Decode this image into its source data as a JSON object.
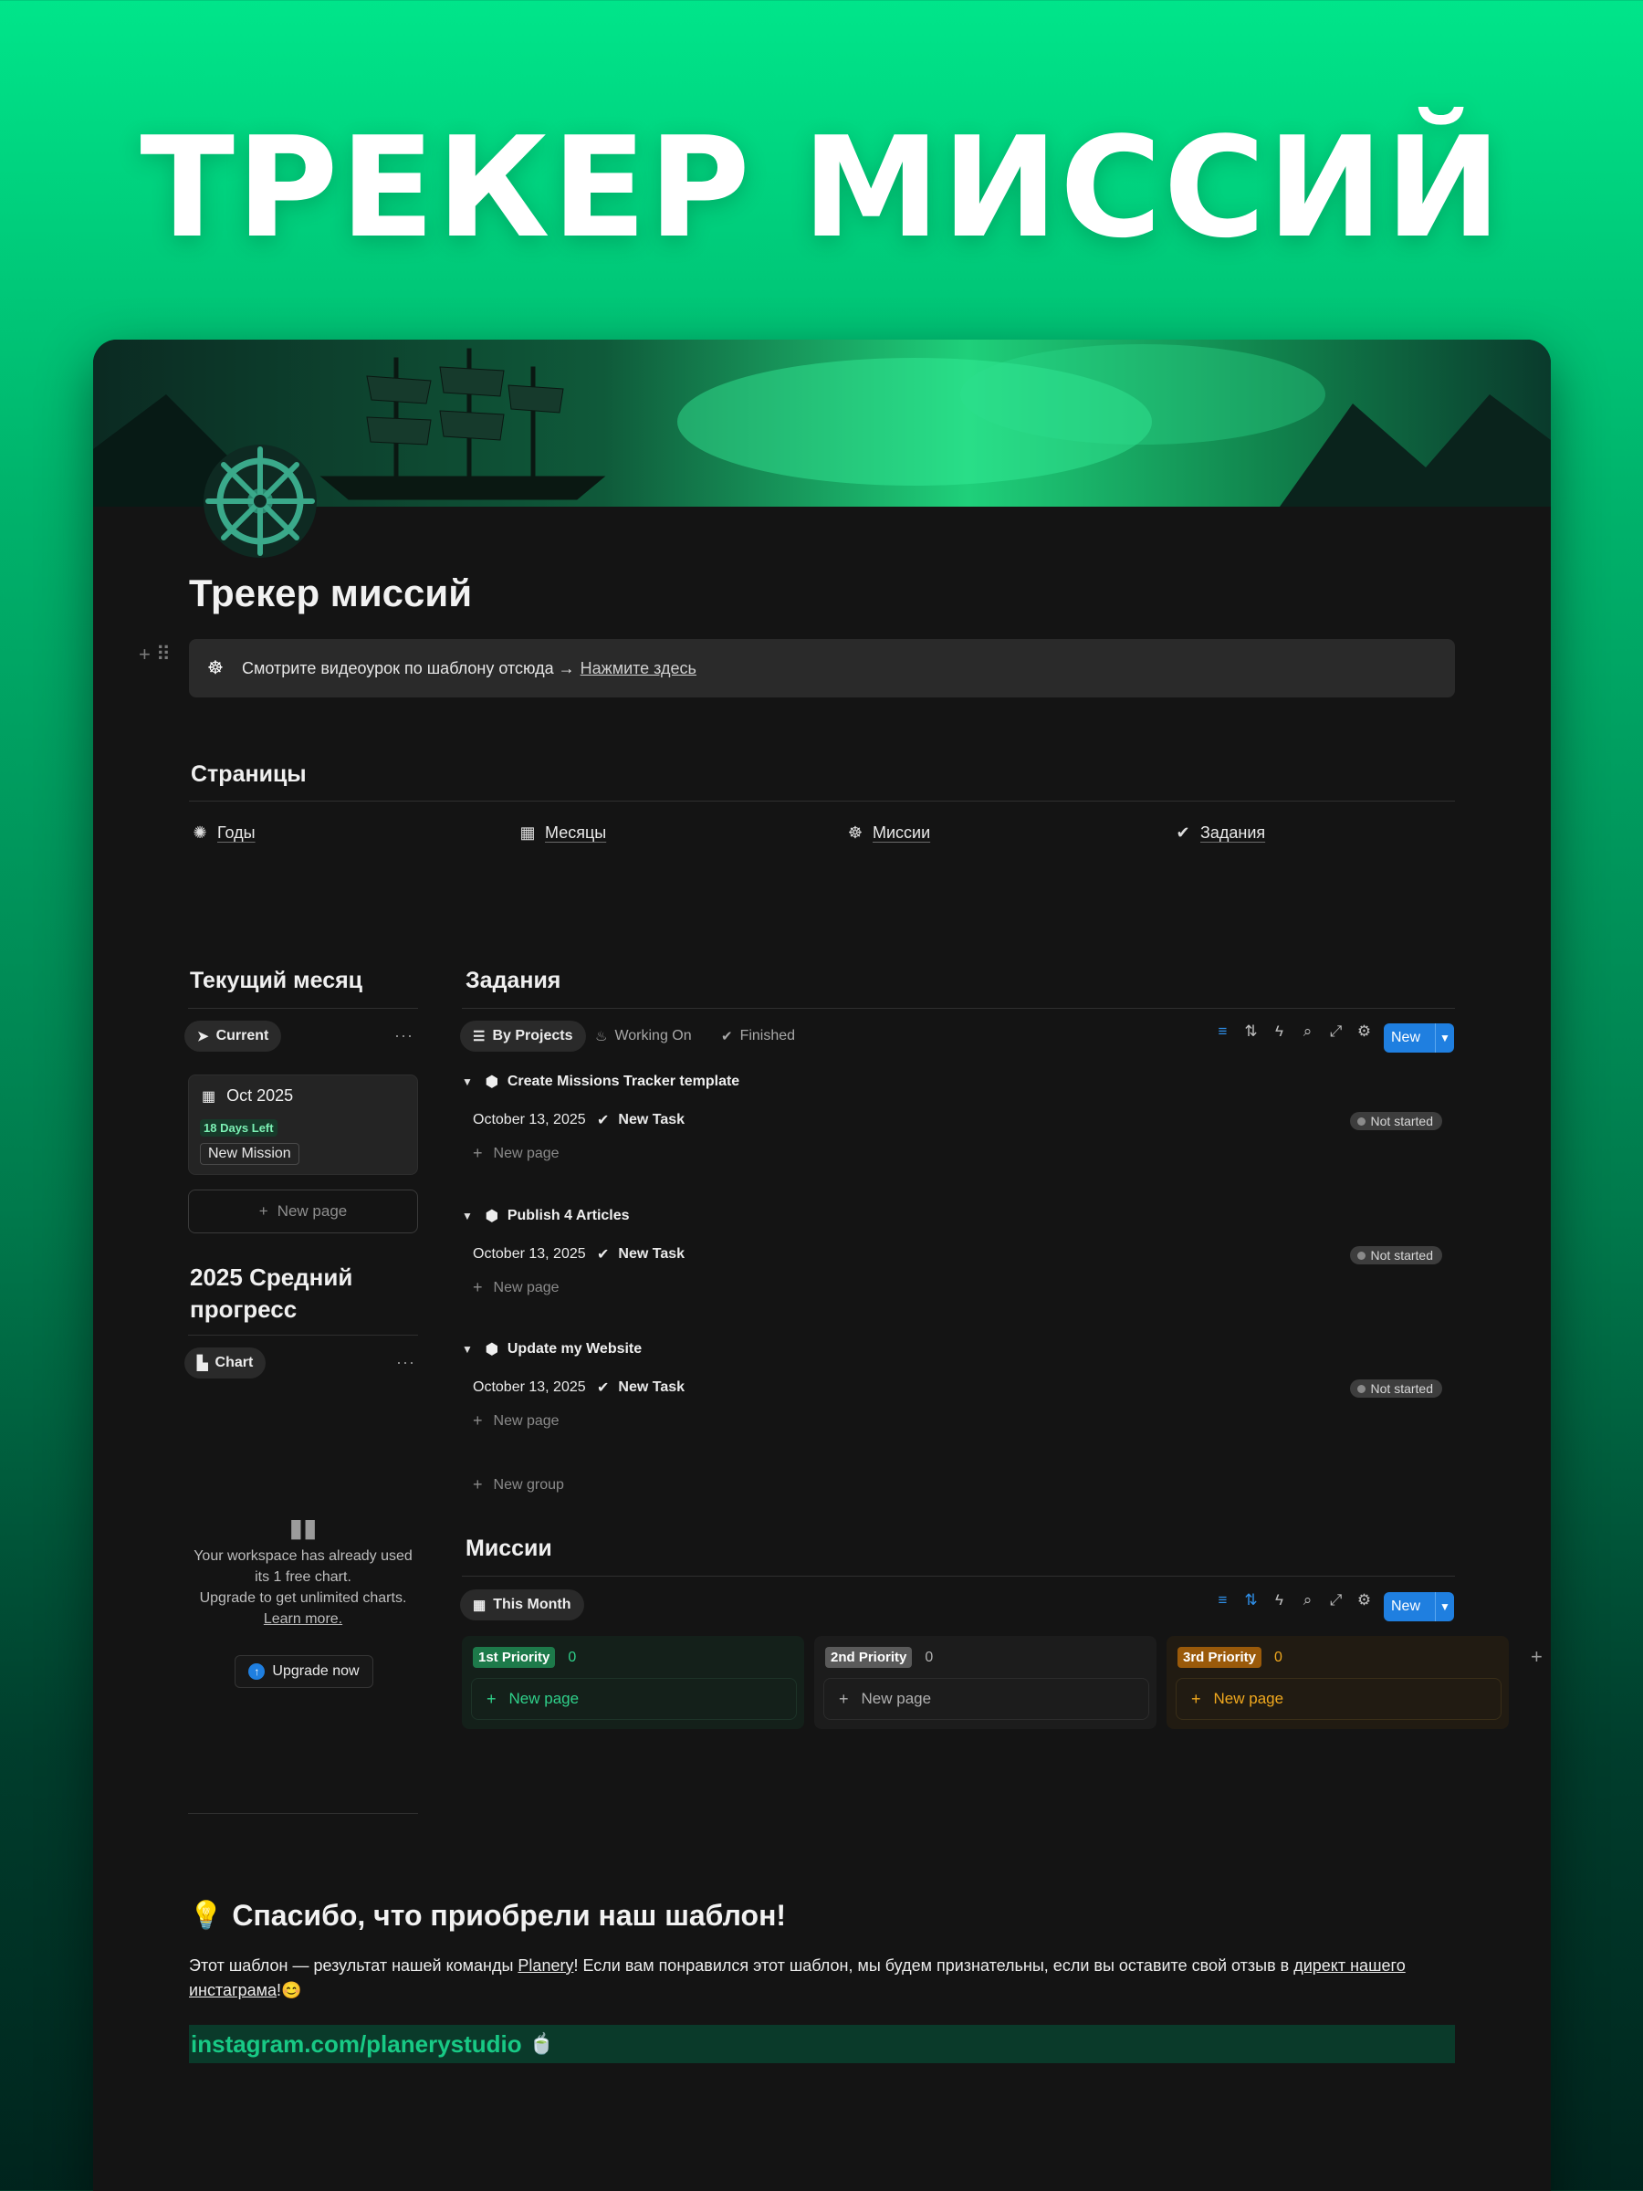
{
  "hero": {
    "title": "ТРЕКЕР МИССИЙ"
  },
  "page": {
    "title": "Трекер миссий",
    "callout": {
      "icon": "helm-icon",
      "text": "Смотрите видеоурок по шаблону отсюда →",
      "link": "Нажмите здесь"
    }
  },
  "pages_section": {
    "heading": "Страницы",
    "links": [
      {
        "icon": "sparkle-icon",
        "label": "Годы"
      },
      {
        "icon": "calendar-icon",
        "label": "Месяцы"
      },
      {
        "icon": "helm-icon",
        "label": "Миссии"
      },
      {
        "icon": "check-badge-icon",
        "label": "Задания"
      }
    ]
  },
  "current_month": {
    "heading": "Текущий месяц",
    "view": "Current",
    "more": "···",
    "card": {
      "date": "Oct 2025",
      "days_left": "18 Days Left",
      "mission": "New Mission"
    },
    "new_page": "New page"
  },
  "progress": {
    "heading": "2025 Средний прогресс",
    "view": "Chart",
    "more": "···",
    "empty_line1": "Your workspace has already used its 1 free chart.",
    "empty_line2": "Upgrade to get unlimited charts.",
    "learn_more": "Learn more.",
    "upgrade": "Upgrade now"
  },
  "tasks": {
    "heading": "Задания",
    "tabs": [
      {
        "icon": "list-icon",
        "label": "By Projects"
      },
      {
        "icon": "fire-icon",
        "label": "Working On"
      },
      {
        "icon": "check-badge-icon",
        "label": "Finished"
      }
    ],
    "new_button": "New",
    "groups": [
      {
        "title": "Create Missions Tracker template",
        "date": "October 13, 2025",
        "task": "New Task",
        "status": "Not started",
        "add": "New page"
      },
      {
        "title": "Publish 4 Articles",
        "date": "October 13, 2025",
        "task": "New Task",
        "status": "Not started",
        "add": "New page"
      },
      {
        "title": "Update my Website",
        "date": "October 13, 2025",
        "task": "New Task",
        "status": "Not started",
        "add": "New page"
      }
    ],
    "new_group": "New group"
  },
  "missions": {
    "heading": "Миссии",
    "view": "This Month",
    "new_button": "New",
    "columns": [
      {
        "tag": "1st Priority",
        "count": "0",
        "add": "New page",
        "tag_color": "#1d7a4a",
        "text_color": "#2fd08a",
        "bg": "#14201a"
      },
      {
        "tag": "2nd Priority",
        "count": "0",
        "add": "New page",
        "tag_color": "#5a5a5a",
        "text_color": "#b0b0b0",
        "bg": "#1c1c1c"
      },
      {
        "tag": "3rd Priority",
        "count": "0",
        "add": "New page",
        "tag_color": "#9a5a0a",
        "text_color": "#f0a81e",
        "bg": "#211b12"
      }
    ]
  },
  "thanks": {
    "title": "Спасибо, что приобрели наш шаблон!",
    "text_a": "Этот шаблон — результат нашей команды ",
    "brand": "Planery",
    "text_b": "! Если вам понравился этот шаблон, мы будем признательны, если вы оставите свой отзыв в ",
    "link": "директ нашего инстаграма",
    "text_c": "!😊",
    "instagram": "instagram.com/planerystudio"
  },
  "colors": {
    "accent_green": "#00e58a",
    "blue": "#1f7fe0",
    "bg": "#141414"
  }
}
